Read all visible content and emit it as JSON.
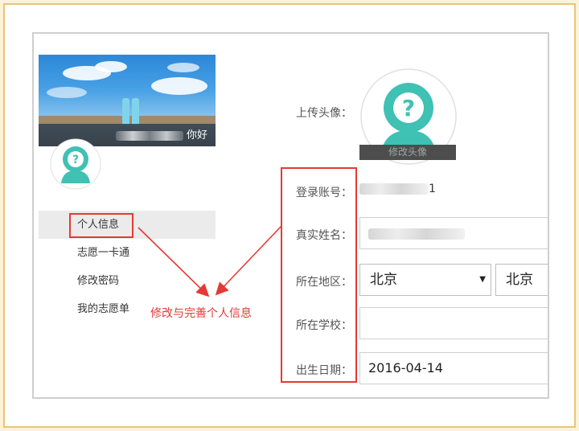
{
  "sidebar": {
    "greeting_suffix": "你好",
    "nav_items": [
      {
        "label": "个人信息",
        "active": true
      },
      {
        "label": "志愿一卡通",
        "active": false
      },
      {
        "label": "修改密码",
        "active": false
      },
      {
        "label": "我的志愿单",
        "active": false
      }
    ]
  },
  "form": {
    "avatar_label": "上传头像：",
    "edit_avatar_button": "修改头像",
    "account_label": "登录账号：",
    "account_value_tail": "1",
    "realname_label": "真实姓名：",
    "region_label": "所在地区：",
    "province_select": "北京",
    "city_select": "北京",
    "school_label": "所在学校：",
    "school_value": "",
    "birthday_label": "出生日期：",
    "birthday_value": "2016-04-14"
  },
  "annotation": {
    "text": "修改与完善个人信息"
  },
  "colors": {
    "annotation_red": "#e53935",
    "avatar_teal": "#3fc1b4",
    "page_background": "#fbf2d9"
  },
  "icons": [
    "avatar-placeholder-icon",
    "question-mark-icon",
    "dropdown-arrow-icon"
  ]
}
